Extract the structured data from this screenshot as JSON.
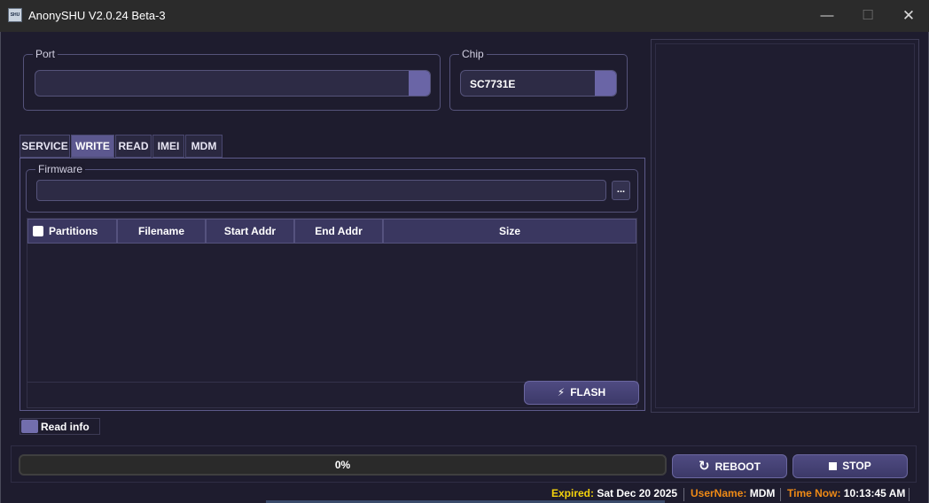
{
  "window": {
    "title": "AnonySHU V2.0.24 Beta-3",
    "icon_text": "SHU",
    "minimize_glyph": "—",
    "maximize_glyph": "☐",
    "close_glyph": "✕"
  },
  "port": {
    "label": "Port",
    "value": ""
  },
  "chip": {
    "label": "Chip",
    "value": "SC7731E"
  },
  "tabs": [
    {
      "label": "SERVICE",
      "active": false
    },
    {
      "label": "WRITE",
      "active": true
    },
    {
      "label": "READ",
      "active": false
    },
    {
      "label": "IMEI",
      "active": false
    },
    {
      "label": "MDM",
      "active": false
    }
  ],
  "firmware": {
    "label": "Firmware",
    "path": "",
    "browse_label": "..."
  },
  "table": {
    "columns": [
      "Partitions",
      "Filename",
      "Start Addr",
      "End Addr",
      "Size"
    ],
    "rows": []
  },
  "flash_button": {
    "label": "FLASH",
    "icon": "lightning-icon"
  },
  "read_info": {
    "label": "Read info"
  },
  "progress": {
    "value": 0,
    "text": "0%"
  },
  "reboot_button": {
    "label": "REBOOT",
    "icon": "refresh-icon"
  },
  "stop_button": {
    "label": "STOP",
    "icon": "stop-icon"
  },
  "status": {
    "expired_label": "Expired:",
    "expired_value": "Sat Dec 20 2025",
    "username_label": "UserName:",
    "username_value": "MDM",
    "time_label": "Time Now:",
    "time_value": "10:13:45 AM"
  },
  "colors": {
    "background": "#1e1c2e",
    "accent": "#6a65a6",
    "expired_label": "#f4d20c",
    "status_label": "#ef8a16"
  }
}
